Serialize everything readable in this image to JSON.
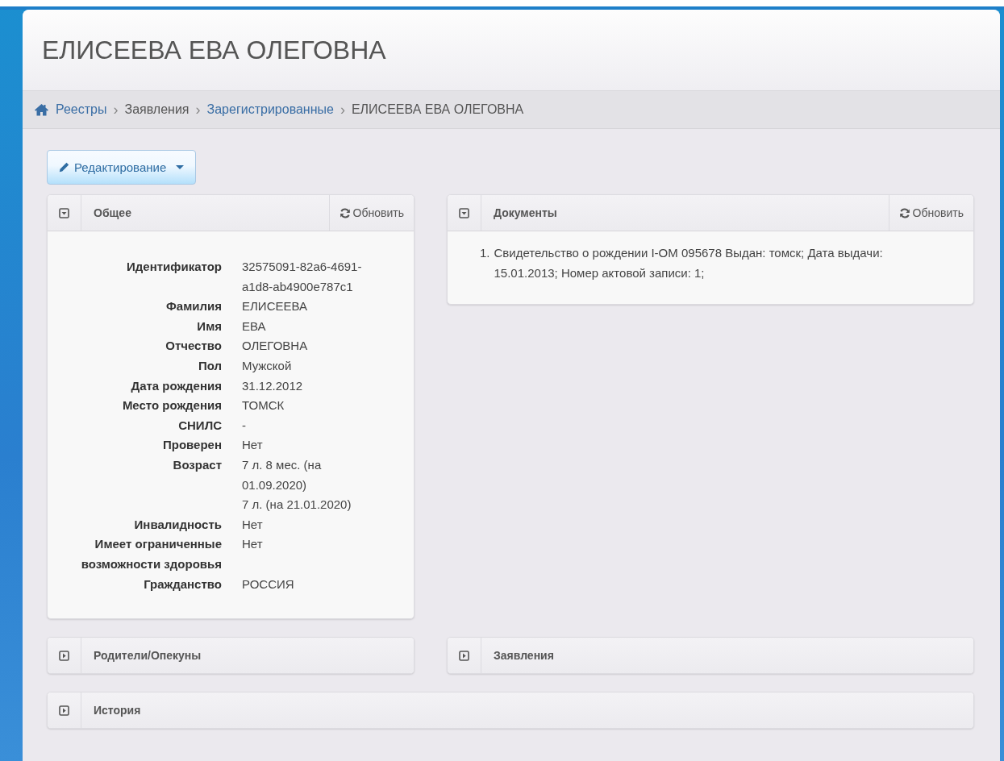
{
  "page_title": "ЕЛИСЕЕВА ЕВА ОЛЕГОВНА",
  "breadcrumb": [
    {
      "label": "Реестры",
      "link": true
    },
    {
      "label": "Заявления",
      "link": false
    },
    {
      "label": "Зарегистрированные",
      "link": true
    },
    {
      "label": "ЕЛИСЕЕВА ЕВА ОЛЕГОВНА",
      "link": false
    }
  ],
  "breadcrumb_separator": "›",
  "edit_button": {
    "label": "Редактирование"
  },
  "panel_rows": [
    [
      {
        "kind": "fields",
        "title": "Общее",
        "expanded": true,
        "refresh_label": "Обновить",
        "fields": [
          {
            "label": "Идентификатор",
            "value": [
              "32575091-82a6-4691-a1d8-ab4900e787c1"
            ]
          },
          {
            "label": "Фамилия",
            "value": [
              "ЕЛИСЕЕВА"
            ]
          },
          {
            "label": "Имя",
            "value": [
              "ЕВА"
            ]
          },
          {
            "label": "Отчество",
            "value": [
              "ОЛЕГОВНА"
            ]
          },
          {
            "label": "Пол",
            "value": [
              "Мужской"
            ]
          },
          {
            "label": "Дата рождения",
            "value": [
              "31.12.2012"
            ]
          },
          {
            "label": "Место рождения",
            "value": [
              "ТОМСК"
            ]
          },
          {
            "label": "СНИЛС",
            "value": [
              "-"
            ]
          },
          {
            "label": "Проверен",
            "value": [
              "Нет"
            ]
          },
          {
            "label": "Возраст",
            "value": [
              "7 л. 8 мес. (на 01.09.2020)",
              "7 л. (на 21.01.2020)"
            ]
          },
          {
            "label": "Инвалидность",
            "value": [
              "Нет"
            ]
          },
          {
            "label": "Имеет ограниченные возможности здоровья",
            "value": [
              "Нет"
            ]
          },
          {
            "label": "Гражданство",
            "value": [
              "РОССИЯ"
            ]
          }
        ]
      },
      {
        "kind": "list",
        "title": "Документы",
        "expanded": true,
        "refresh_label": "Обновить",
        "items": [
          {
            "number": "1.",
            "text": "Свидетельство о рождении I-ОМ 095678 Выдан: томск; Дата выдачи: 15.01.2013; Номер актовой записи: 1;"
          }
        ]
      }
    ],
    [
      {
        "title": "Родители/Опекуны",
        "expanded": false
      },
      {
        "title": "Заявления",
        "expanded": false
      }
    ],
    [
      {
        "title": "История",
        "expanded": false
      }
    ]
  ]
}
